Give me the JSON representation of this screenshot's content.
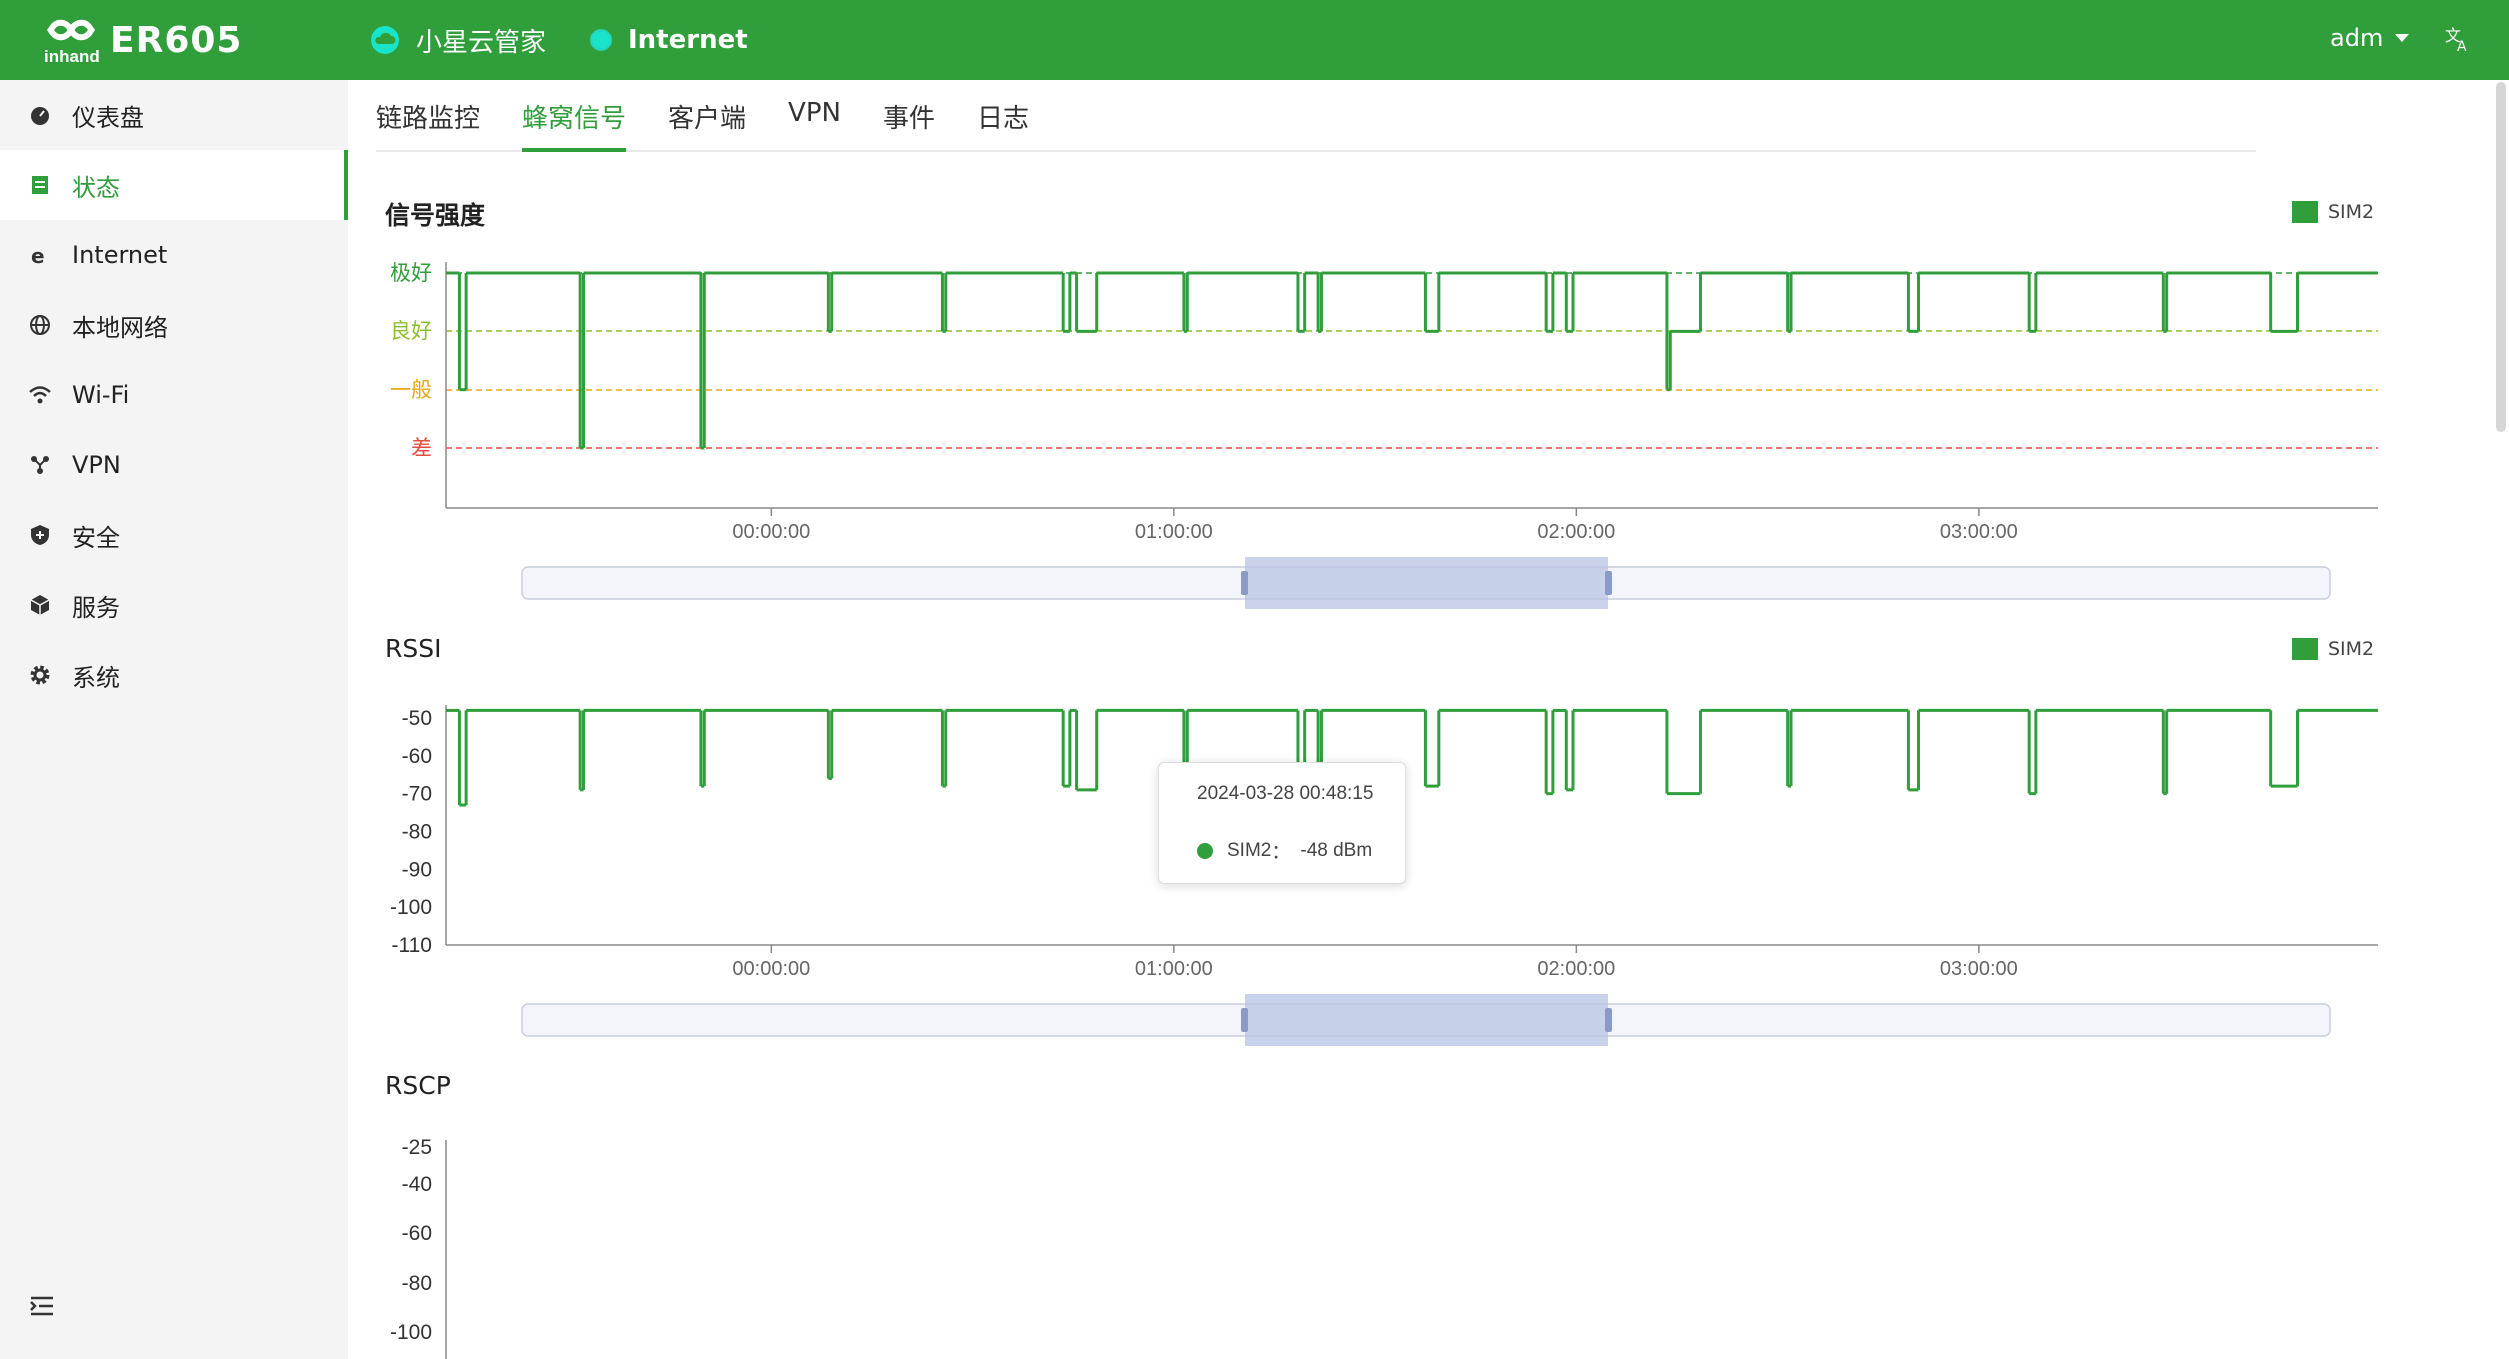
{
  "header": {
    "product": "ER605",
    "brand": "inhand",
    "cloud_label": "小星云管家",
    "internet_label": "Internet",
    "user": "adm",
    "lang_icon": "translate-icon",
    "color": "#2f9e3b"
  },
  "sidebar": {
    "items": [
      {
        "label": "仪表盘",
        "icon": "dashboard-icon"
      },
      {
        "label": "状态",
        "icon": "status-icon",
        "active": true
      },
      {
        "label": "Internet",
        "icon": "internet-explorer-icon"
      },
      {
        "label": "本地网络",
        "icon": "globe-icon"
      },
      {
        "label": "Wi-Fi",
        "icon": "wifi-icon"
      },
      {
        "label": "VPN",
        "icon": "vpn-icon"
      },
      {
        "label": "安全",
        "icon": "shield-icon"
      },
      {
        "label": "服务",
        "icon": "cube-icon"
      },
      {
        "label": "系统",
        "icon": "gear-icon"
      }
    ],
    "collapse_icon": "menu-collapse-icon"
  },
  "tabs": [
    {
      "label": "链路监控"
    },
    {
      "label": "蜂窝信号",
      "active": true
    },
    {
      "label": "客户端"
    },
    {
      "label": "VPN"
    },
    {
      "label": "事件"
    },
    {
      "label": "日志"
    }
  ],
  "tooltip": {
    "time": "2024-03-28 00:48:15",
    "series": "SIM2",
    "value_text": "-48 dBm"
  },
  "chart_data": [
    {
      "type": "line",
      "title": "信号强度",
      "legend": "SIM2",
      "legend_position": "top-right",
      "y_categories": [
        "差",
        "一般",
        "良好",
        "极好"
      ],
      "y_category_colors": [
        "#e74c3c",
        "#e6a817",
        "#8bbf2a",
        "#2f9e3b"
      ],
      "x_ticks": [
        "00:00:00",
        "01:00:00",
        "02:00:00",
        "03:00:00"
      ],
      "series": [
        {
          "name": "SIM2",
          "color": "#2f9e3b",
          "points": [
            [
              0,
              3
            ],
            [
              2,
              3
            ],
            [
              2,
              1
            ],
            [
              3,
              1
            ],
            [
              3,
              3
            ],
            [
              20,
              3
            ],
            [
              20,
              0
            ],
            [
              20.5,
              0
            ],
            [
              20.5,
              3
            ],
            [
              38,
              3
            ],
            [
              38,
              0
            ],
            [
              38.5,
              0
            ],
            [
              38.5,
              3
            ],
            [
              57,
              3
            ],
            [
              57,
              2
            ],
            [
              57.5,
              2
            ],
            [
              57.5,
              3
            ],
            [
              74,
              3
            ],
            [
              74,
              2
            ],
            [
              74.5,
              2
            ],
            [
              74.5,
              3
            ],
            [
              92,
              3
            ],
            [
              92,
              2
            ],
            [
              93,
              2
            ],
            [
              93,
              3
            ],
            [
              94,
              3
            ],
            [
              94,
              2
            ],
            [
              97,
              2
            ],
            [
              97,
              3
            ],
            [
              110,
              3
            ],
            [
              110,
              2
            ],
            [
              110.5,
              2
            ],
            [
              110.5,
              3
            ],
            [
              127,
              3
            ],
            [
              127,
              2
            ],
            [
              128,
              2
            ],
            [
              128,
              3
            ],
            [
              130,
              3
            ],
            [
              130,
              2
            ],
            [
              130.5,
              2
            ],
            [
              130.5,
              3
            ],
            [
              146,
              3
            ],
            [
              146,
              2
            ],
            [
              148,
              2
            ],
            [
              148,
              3
            ],
            [
              164,
              3
            ],
            [
              164,
              2
            ],
            [
              165,
              2
            ],
            [
              165,
              3
            ],
            [
              167,
              3
            ],
            [
              167,
              2
            ],
            [
              168,
              2
            ],
            [
              168,
              3
            ],
            [
              182,
              3
            ],
            [
              182,
              1
            ],
            [
              182.5,
              1
            ],
            [
              182.5,
              2
            ],
            [
              187,
              2
            ],
            [
              187,
              3
            ],
            [
              200,
              3
            ],
            [
              200,
              2
            ],
            [
              200.5,
              2
            ],
            [
              200.5,
              3
            ],
            [
              218,
              3
            ],
            [
              218,
              2
            ],
            [
              219.5,
              2
            ],
            [
              219.5,
              3
            ],
            [
              236,
              3
            ],
            [
              236,
              2
            ],
            [
              237,
              2
            ],
            [
              237,
              3
            ],
            [
              256,
              3
            ],
            [
              256,
              2
            ],
            [
              256.5,
              2
            ],
            [
              256.5,
              3
            ],
            [
              272,
              3
            ],
            [
              272,
              2
            ],
            [
              276,
              2
            ],
            [
              276,
              3
            ],
            [
              288,
              3
            ]
          ]
        }
      ]
    },
    {
      "type": "line",
      "title": "RSSI",
      "legend": "SIM2",
      "legend_position": "top-right",
      "y_ticks": [
        -50,
        -60,
        -70,
        -80,
        -90,
        -100,
        -110
      ],
      "ylim": [
        -110,
        -48
      ],
      "x_ticks": [
        "00:00:00",
        "01:00:00",
        "02:00:00",
        "03:00:00"
      ],
      "series": [
        {
          "name": "SIM2",
          "color": "#2f9e3b",
          "points": [
            [
              0,
              -48
            ],
            [
              2,
              -48
            ],
            [
              2,
              -73
            ],
            [
              3,
              -73
            ],
            [
              3,
              -48
            ],
            [
              20,
              -48
            ],
            [
              20,
              -69
            ],
            [
              20.5,
              -69
            ],
            [
              20.5,
              -48
            ],
            [
              38,
              -48
            ],
            [
              38,
              -68
            ],
            [
              38.5,
              -68
            ],
            [
              38.5,
              -48
            ],
            [
              57,
              -48
            ],
            [
              57,
              -66
            ],
            [
              57.5,
              -66
            ],
            [
              57.5,
              -48
            ],
            [
              74,
              -48
            ],
            [
              74,
              -68
            ],
            [
              74.5,
              -68
            ],
            [
              74.5,
              -48
            ],
            [
              92,
              -48
            ],
            [
              92,
              -68
            ],
            [
              93,
              -68
            ],
            [
              93,
              -48
            ],
            [
              94,
              -48
            ],
            [
              94,
              -69
            ],
            [
              97,
              -69
            ],
            [
              97,
              -48
            ],
            [
              110,
              -48
            ],
            [
              110,
              -62
            ],
            [
              110.5,
              -62
            ],
            [
              110.5,
              -48
            ],
            [
              127,
              -48
            ],
            [
              127,
              -62
            ],
            [
              128,
              -62
            ],
            [
              128,
              -48
            ],
            [
              130,
              -48
            ],
            [
              130,
              -62
            ],
            [
              130.5,
              -62
            ],
            [
              130.5,
              -48
            ],
            [
              146,
              -48
            ],
            [
              146,
              -68
            ],
            [
              148,
              -68
            ],
            [
              148,
              -48
            ],
            [
              164,
              -48
            ],
            [
              164,
              -70
            ],
            [
              165,
              -70
            ],
            [
              165,
              -48
            ],
            [
              167,
              -48
            ],
            [
              167,
              -69
            ],
            [
              168,
              -69
            ],
            [
              168,
              -48
            ],
            [
              182,
              -48
            ],
            [
              182,
              -70
            ],
            [
              187,
              -70
            ],
            [
              187,
              -48
            ],
            [
              200,
              -48
            ],
            [
              200,
              -68
            ],
            [
              200.5,
              -68
            ],
            [
              200.5,
              -48
            ],
            [
              218,
              -48
            ],
            [
              218,
              -69
            ],
            [
              219.5,
              -69
            ],
            [
              219.5,
              -48
            ],
            [
              236,
              -48
            ],
            [
              236,
              -70
            ],
            [
              237,
              -70
            ],
            [
              237,
              -48
            ],
            [
              256,
              -48
            ],
            [
              256,
              -70
            ],
            [
              256.5,
              -70
            ],
            [
              256.5,
              -48
            ],
            [
              272,
              -48
            ],
            [
              272,
              -68
            ],
            [
              276,
              -68
            ],
            [
              276,
              -48
            ],
            [
              288,
              -48
            ]
          ]
        }
      ]
    },
    {
      "type": "line",
      "title": "RSCP",
      "y_ticks": [
        -25,
        -40,
        -60,
        -80,
        -100
      ]
    }
  ]
}
